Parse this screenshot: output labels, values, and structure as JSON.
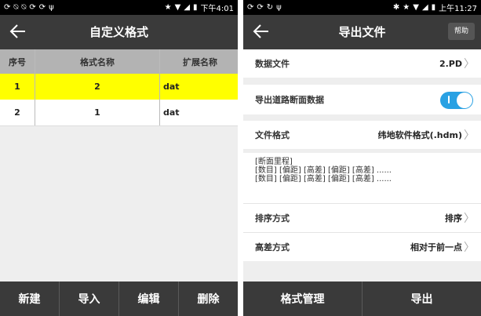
{
  "left": {
    "status": {
      "time": "下午4:01"
    },
    "title": "自定义格式",
    "table": {
      "headers": [
        "序号",
        "格式名称",
        "扩展名称"
      ],
      "rows": [
        [
          "1",
          "2",
          "dat"
        ],
        [
          "2",
          "1",
          "dat"
        ]
      ]
    },
    "buttons": [
      "新建",
      "导入",
      "编辑",
      "删除"
    ]
  },
  "right": {
    "status": {
      "time": "上午11:27"
    },
    "title": "导出文件",
    "help": "帮助",
    "data_file": {
      "label": "数据文件",
      "value": "2.PD"
    },
    "road_section": {
      "label": "导出道路断面数据",
      "on": true
    },
    "file_format": {
      "label": "文件格式",
      "value": "纬地软件格式(.hdm)"
    },
    "format_note": {
      "line1": "[断面里程]",
      "line2": "[数目] [偏距] [高差] [偏距] [高差] ......",
      "line3": "[数目] [偏距] [高差] [偏距] [高差] ......"
    },
    "sort": {
      "label": "排序方式",
      "value": "排序"
    },
    "height": {
      "label": "高差方式",
      "value": "相对于前一点"
    },
    "buttons": [
      "格式管理",
      "导出"
    ]
  },
  "colors": {
    "accent": "#29a1e3",
    "selection": "#ffff00",
    "bar": "#3a3a3a"
  }
}
